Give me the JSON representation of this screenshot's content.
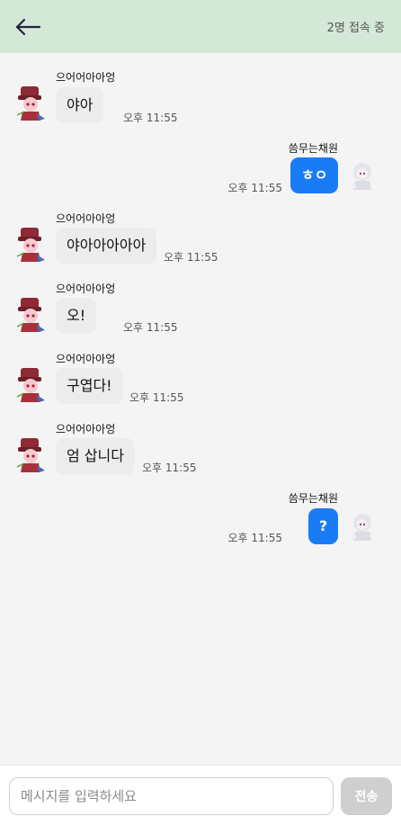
{
  "header": {
    "back_icon": "arrow-left-icon",
    "online_status": "2명 접속 중"
  },
  "messages": [
    {
      "side": "left",
      "sender": "으어어아아엉",
      "text": "야아",
      "time": "오후 11:55"
    },
    {
      "side": "right",
      "sender": "씀무는채원",
      "text": "ㅎㅇ",
      "time": "오후 11:55"
    },
    {
      "side": "left",
      "sender": "으어어아아엉",
      "text": "야아아아아아",
      "time": "오후 11:55"
    },
    {
      "side": "left",
      "sender": "으어어아아엉",
      "text": "오!",
      "time": "오후 11:55"
    },
    {
      "side": "left",
      "sender": "으어어아아엉",
      "text": "구엽다!",
      "time": "오후 11:55"
    },
    {
      "side": "left",
      "sender": "으어어아아엉",
      "text": "엄 삽니다",
      "time": "오후 11:55"
    },
    {
      "side": "right",
      "sender": "씀무는채원",
      "text": "?",
      "time": "오후 11:55"
    }
  ],
  "composer": {
    "placeholder": "메시지를 입력하세요",
    "send_label": "전송"
  },
  "colors": {
    "header_bg": "#d3e8d7",
    "own_bubble": "#1a7cf5",
    "other_bubble": "#ececec",
    "send_button_disabled": "#cfcfcf"
  }
}
